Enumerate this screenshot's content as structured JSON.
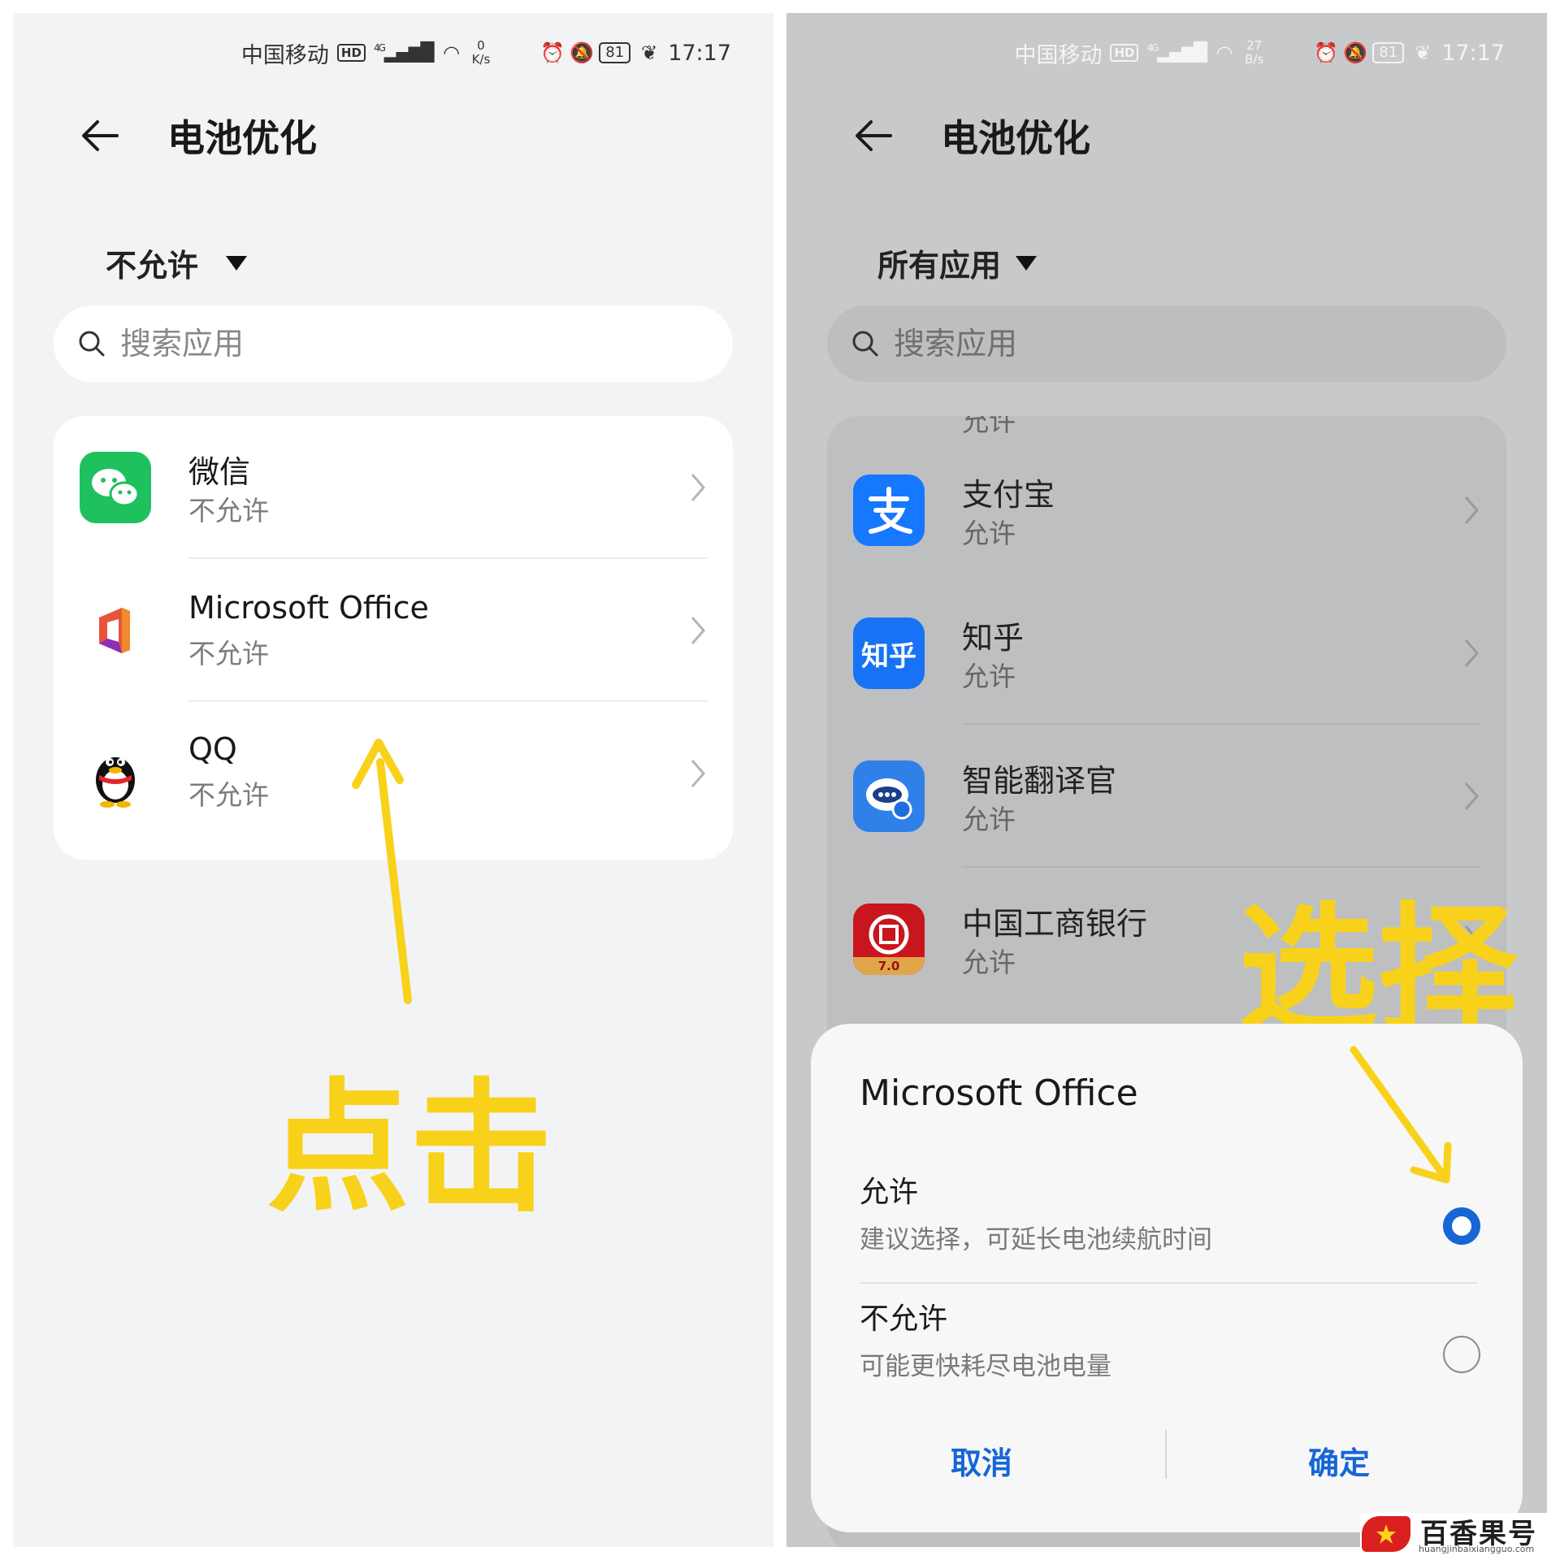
{
  "left": {
    "status_bar": {
      "carrier": "中国移动",
      "hd": "HD",
      "signal": "4G",
      "speed_value": "0",
      "speed_unit": "K/s",
      "battery": "81",
      "time": "17:17"
    },
    "header": {
      "title": "电池优化"
    },
    "filter": {
      "label": "不允许"
    },
    "search": {
      "placeholder": "搜索应用"
    },
    "apps": [
      {
        "name": "微信",
        "status": "不允许",
        "icon": "wechat-icon"
      },
      {
        "name": "Microsoft Office",
        "status": "不允许",
        "icon": "office-icon"
      },
      {
        "name": "QQ",
        "status": "不允许",
        "icon": "qq-icon"
      }
    ],
    "annotation": "点击"
  },
  "right": {
    "status_bar": {
      "carrier": "中国移动",
      "hd": "HD",
      "signal": "4G",
      "speed_value": "27",
      "speed_unit": "B/s",
      "battery": "81",
      "time": "17:17"
    },
    "header": {
      "title": "电池优化"
    },
    "filter": {
      "label": "所有应用"
    },
    "search": {
      "placeholder": "搜索应用"
    },
    "partial_item_status": "允许",
    "apps": [
      {
        "name": "支付宝",
        "status": "允许",
        "icon": "alipay-icon"
      },
      {
        "name": "知乎",
        "status": "允许",
        "icon": "zhihu-icon",
        "icon_text": "知乎"
      },
      {
        "name": "智能翻译官",
        "status": "允许",
        "icon": "translator-icon"
      },
      {
        "name": "中国工商银行",
        "status": "允许",
        "icon": "icbc-icon",
        "icon_text": "7.0"
      }
    ],
    "annotation": "选择",
    "dialog": {
      "title": "Microsoft Office",
      "options": [
        {
          "label": "允许",
          "desc": "建议选择，可延长电池续航时间",
          "selected": true
        },
        {
          "label": "不允许",
          "desc": "可能更快耗尽电池电量",
          "selected": false
        }
      ],
      "cancel": "取消",
      "confirm": "确定"
    }
  },
  "watermark": {
    "name": "百香果号",
    "url": "huangjinbaixiangguo.com"
  },
  "colors": {
    "annotation": "#f8d21a",
    "accent": "#1766d6",
    "left_bg": "#f1f3f5",
    "right_bg": "#c8c9cb"
  }
}
